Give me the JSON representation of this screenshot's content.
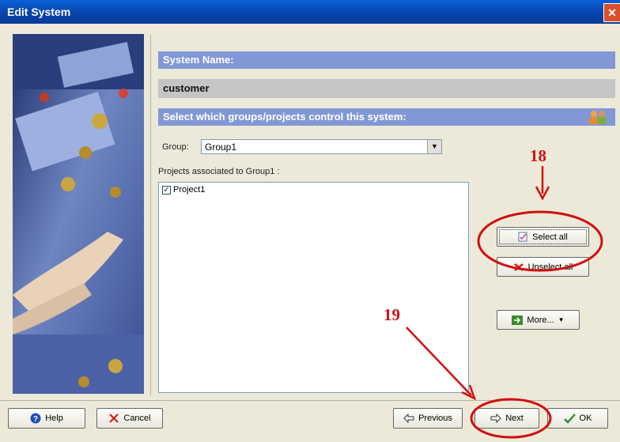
{
  "window": {
    "title": "Edit System",
    "close_label": "✕"
  },
  "system_name": {
    "header": "System Name:",
    "value": "customer"
  },
  "groups_section": {
    "header": "Select which groups/projects control this system:",
    "group_label": "Group:",
    "group_value": "Group1",
    "projects_label": "Projects associated to Group1 :",
    "projects": [
      {
        "label": "Project1",
        "checked": true
      }
    ]
  },
  "side_buttons": {
    "select_all": "Select all",
    "unselect_all": "Unselect all",
    "more": "More..."
  },
  "footer": {
    "help": "Help",
    "cancel": "Cancel",
    "previous": "Previous",
    "next": "Next",
    "ok": "OK"
  },
  "annotations": {
    "a18": "18",
    "a19": "19"
  },
  "colors": {
    "header_bg": "#8298D6",
    "name_bg": "#C5C5C5",
    "annotation": "#D01010",
    "title_bar": "#0842A8"
  }
}
